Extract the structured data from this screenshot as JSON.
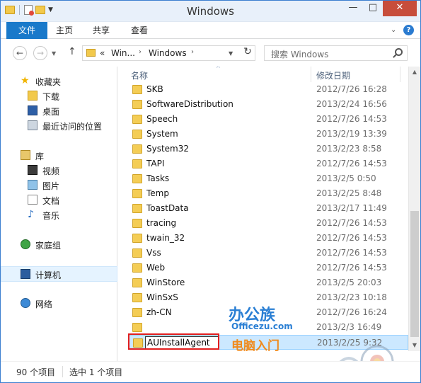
{
  "window": {
    "title": "Windows"
  },
  "quick_access_toolbar": {
    "icons": [
      "folder-icon",
      "properties-icon",
      "new-folder-icon",
      "dropdown-icon"
    ]
  },
  "controls": {
    "minimize": "—",
    "maximize": "□",
    "close": "✕"
  },
  "ribbon": {
    "tabs": [
      {
        "label": "文件",
        "active": true
      },
      {
        "label": "主页"
      },
      {
        "label": "共享"
      },
      {
        "label": "查看"
      }
    ],
    "expand_glyph": "⌄",
    "help": "?"
  },
  "address_bar": {
    "prefix": "«",
    "crumbs": [
      "Win...",
      "Windows"
    ],
    "refresh_glyph": "↻"
  },
  "search": {
    "placeholder": "搜索 Windows"
  },
  "nav_pane": {
    "favorites": {
      "label": "收藏夹",
      "items": [
        "下载",
        "桌面",
        "最近访问的位置"
      ]
    },
    "libraries": {
      "label": "库",
      "items": [
        "视频",
        "图片",
        "文档",
        "音乐"
      ]
    },
    "homegroup": "家庭组",
    "computer": "计算机",
    "network": "网络"
  },
  "columns": {
    "name": "名称",
    "modified": "修改日期"
  },
  "files": [
    {
      "name": "SKB",
      "date": "2012/7/26 16:28"
    },
    {
      "name": "SoftwareDistribution",
      "date": "2013/2/24 16:56"
    },
    {
      "name": "Speech",
      "date": "2012/7/26 14:53"
    },
    {
      "name": "System",
      "date": "2013/2/19 13:39"
    },
    {
      "name": "System32",
      "date": "2013/2/23 8:58"
    },
    {
      "name": "TAPI",
      "date": "2012/7/26 14:53"
    },
    {
      "name": "Tasks",
      "date": "2013/2/5 0:50"
    },
    {
      "name": "Temp",
      "date": "2013/2/25 8:48"
    },
    {
      "name": "ToastData",
      "date": "2013/2/17 11:49"
    },
    {
      "name": "tracing",
      "date": "2012/7/26 14:53"
    },
    {
      "name": "twain_32",
      "date": "2012/7/26 14:53"
    },
    {
      "name": "Vss",
      "date": "2012/7/26 14:53"
    },
    {
      "name": "Web",
      "date": "2012/7/26 14:53"
    },
    {
      "name": "WinStore",
      "date": "2013/2/5 20:03"
    },
    {
      "name": "WinSxS",
      "date": "2013/2/23 10:18"
    },
    {
      "name": "zh-CN",
      "date": "2012/7/26 16:24"
    },
    {
      "name": "",
      "date": "2013/2/3 16:49"
    },
    {
      "name": "AUInstallAgent",
      "date": "2013/2/25 9:32",
      "editing": true
    }
  ],
  "status": {
    "count": "90 个项目",
    "selected": "选中 1 个项目"
  },
  "watermark": {
    "brand": "办公族",
    "site": "Officezu.com",
    "tagline": "电脑入门"
  }
}
